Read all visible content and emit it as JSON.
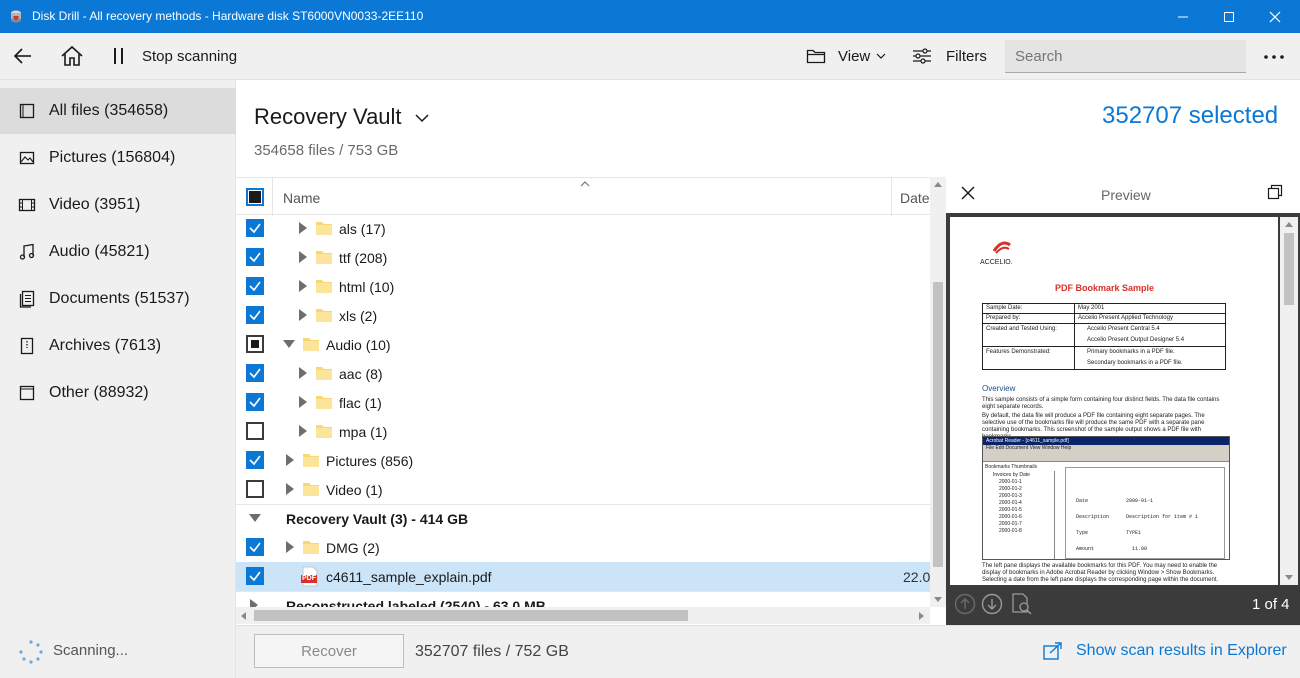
{
  "window": {
    "title": "Disk Drill - All recovery methods - Hardware disk ST6000VN0033-2EE110",
    "accent": "#0a78d4"
  },
  "toolbar": {
    "stop_label": "Stop scanning",
    "view_label": "View",
    "filters_label": "Filters",
    "search_placeholder": "Search"
  },
  "sidebar": {
    "items": [
      {
        "label": "All files (354658)",
        "icon": "all-files-icon"
      },
      {
        "label": "Pictures (156804)",
        "icon": "pictures-icon"
      },
      {
        "label": "Video (3951)",
        "icon": "video-icon"
      },
      {
        "label": "Audio (45821)",
        "icon": "audio-icon"
      },
      {
        "label": "Documents (51537)",
        "icon": "documents-icon"
      },
      {
        "label": "Archives (7613)",
        "icon": "archives-icon"
      },
      {
        "label": "Other (88932)",
        "icon": "other-icon"
      }
    ],
    "status": "Scanning..."
  },
  "main": {
    "title": "Recovery Vault",
    "subtitle": "354658 files / 753 GB",
    "selected": "352707 selected",
    "columns": {
      "name": "Name",
      "date": "Date"
    },
    "rows": [
      {
        "label": "als (17)",
        "check": "on",
        "expand": "right",
        "level": 2
      },
      {
        "label": "ttf (208)",
        "check": "on",
        "expand": "right",
        "level": 2
      },
      {
        "label": "html (10)",
        "check": "on",
        "expand": "right",
        "level": 2
      },
      {
        "label": "xls (2)",
        "check": "on",
        "expand": "right",
        "level": 2
      },
      {
        "label": "Audio (10)",
        "check": "part",
        "expand": "down",
        "level": 1
      },
      {
        "label": "aac (8)",
        "check": "on",
        "expand": "right",
        "level": 2
      },
      {
        "label": "flac (1)",
        "check": "on",
        "expand": "right",
        "level": 2
      },
      {
        "label": "mpa (1)",
        "check": "off",
        "expand": "right",
        "level": 2
      },
      {
        "label": "Pictures (856)",
        "check": "on",
        "expand": "right",
        "level": 1
      },
      {
        "label": "Video (1)",
        "check": "off",
        "expand": "right",
        "level": 1
      }
    ],
    "group1": "Recovery Vault (3) - 414 GB",
    "dmg_row": "DMG (2)",
    "pdf_row": {
      "label": "c4611_sample_explain.pdf",
      "date": "22.0",
      "badge": "PDF"
    },
    "group2": "Reconstructed labeled (2540) - 63.0 MB"
  },
  "preview": {
    "title": "Preview",
    "page": "1 of 4",
    "doc": {
      "logo": "ACCELIO.",
      "heading": "PDF Bookmark Sample",
      "table": [
        [
          "Sample Date:",
          "May 2001"
        ],
        [
          "Prepared by:",
          "Accelio Present Applied Technology"
        ],
        [
          "Created and Tested Using:",
          "Accelio Present Central 5.4"
        ],
        [
          "",
          "Accelio Present Output Designer 5.4"
        ],
        [
          "Features Demonstrated:",
          "Primary bookmarks in a PDF file."
        ],
        [
          "",
          "Secondary bookmarks in a PDF file."
        ]
      ],
      "overview": "Overview",
      "p1": "This sample consists of a simple form containing four distinct fields. The data file contains eight separate records.",
      "p2": "By default, the data file will produce a PDF file containing eight separate pages. The selective use of the bookmarks file will produce the same PDF with a separate pane containing bookmarks. This screenshot of the sample output shows a PDF file with bookmarks.",
      "shot_title": "Acrobat Reader - [c4611_sample.pdf]",
      "shot_menu": "File  Edit  Document  View  Window  Help",
      "shot_tabs": "Bookmarks  Thumbnails",
      "shot_tree": [
        "Invoices by Date",
        "2000-01-1",
        "2000-01-2",
        "2000-01-3",
        "2000-01-4",
        "2000-01-5",
        "2000-01-6",
        "2000-01-7",
        "2000-01-8"
      ],
      "shot_fields": [
        [
          "Date",
          "2000-01-1"
        ],
        [
          "Description",
          "Description for item # 1"
        ],
        [
          "Type",
          "TYPE1"
        ],
        [
          "Amount",
          "11.00"
        ]
      ],
      "p3": "The left pane displays the available bookmarks for this PDF. You may need to enable the display of bookmarks in Adobe Acrobat Reader by clicking Window > Show Bookmarks. Selecting a date from the left pane displays the corresponding page within the document."
    }
  },
  "footer": {
    "recover_label": "Recover",
    "summary": "352707 files / 752 GB",
    "explorer_link": "Show scan results in Explorer"
  }
}
